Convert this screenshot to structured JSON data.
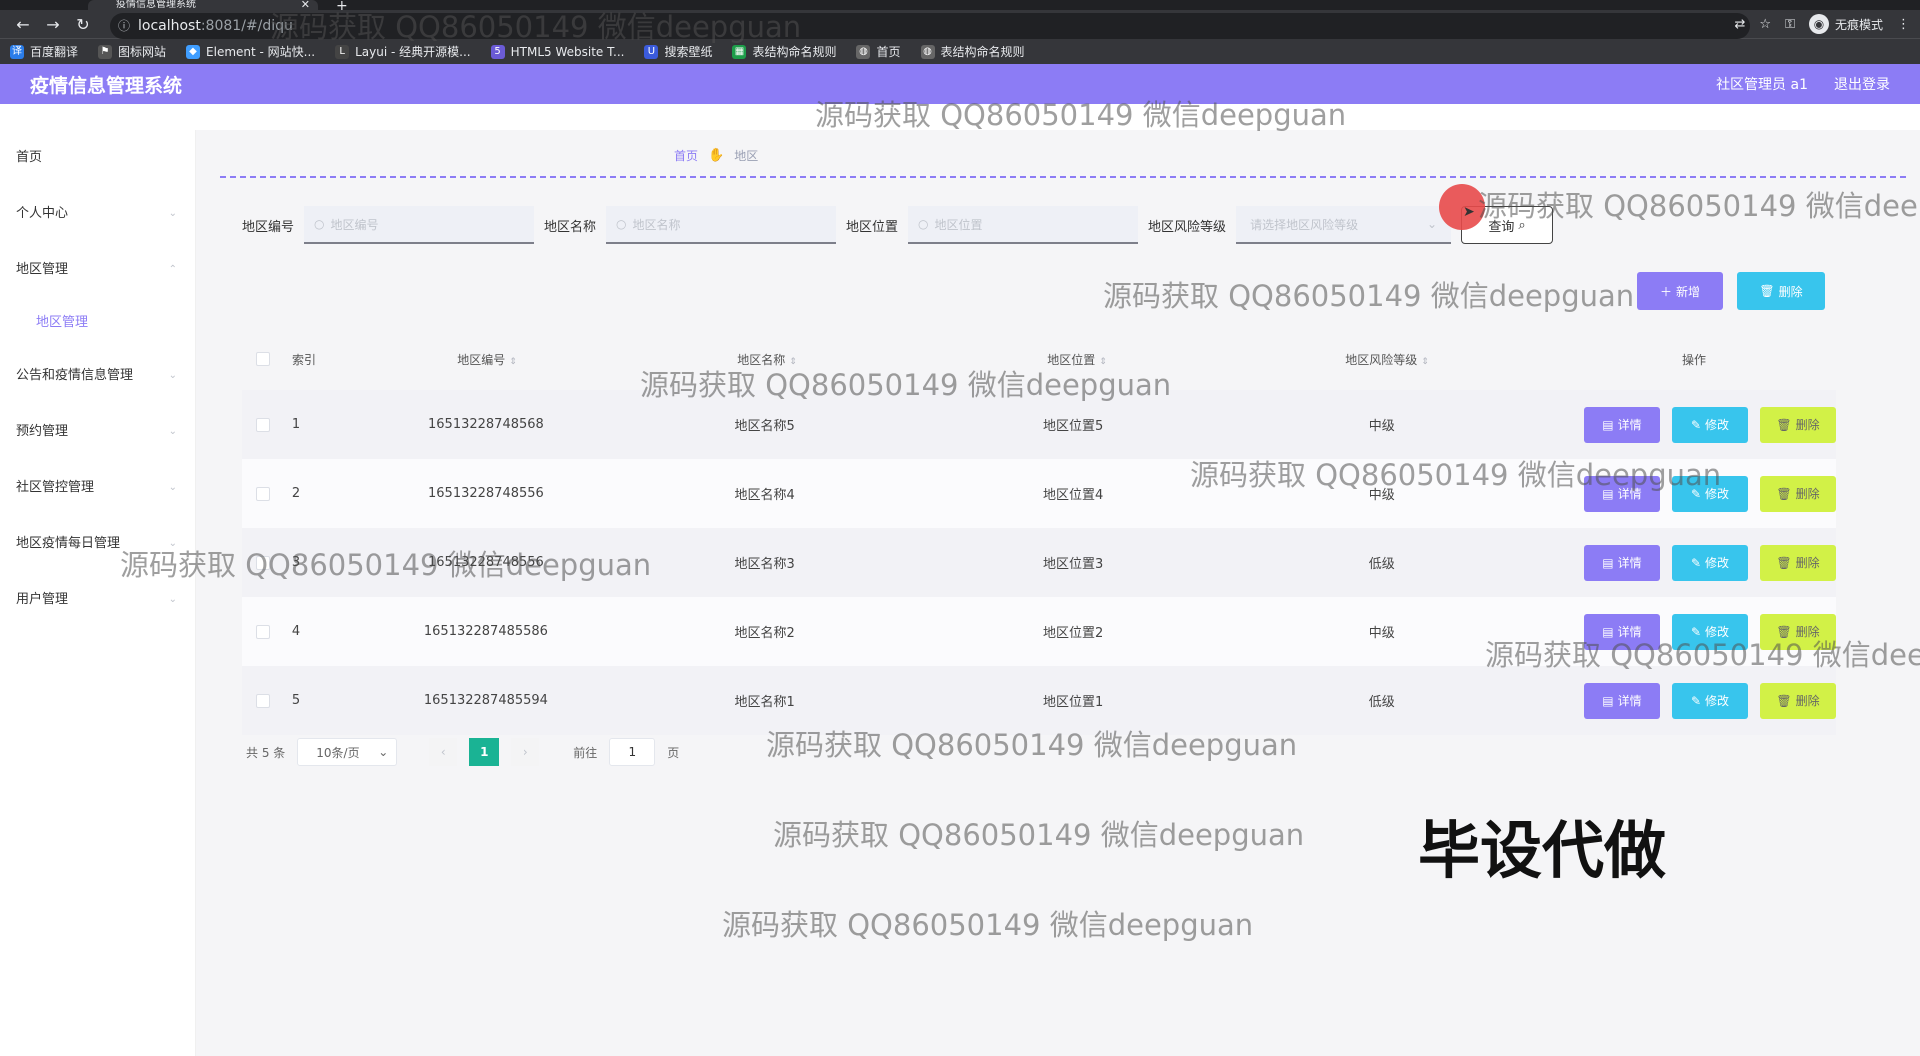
{
  "browser": {
    "tab_title": "疫情信息管理系统",
    "url_host": "localhost",
    "url_path": ":8081/#/diqu",
    "incognito_label": "无痕模式",
    "bookmarks": [
      "百度翻译",
      "图标网站",
      "Element - 网站快...",
      "Layui - 经典开源模...",
      "HTML5 Website T...",
      "搜索壁纸",
      "表结构命名规则",
      "首页",
      "表结构命名规则"
    ]
  },
  "header": {
    "title": "疫情信息管理系统",
    "user": "社区管理员 a1",
    "logout": "退出登录"
  },
  "sidebar": {
    "items": [
      "首页",
      "个人中心",
      "地区管理",
      "公告和疫情信息管理",
      "预约管理",
      "社区管控管理",
      "地区疫情每日管理",
      "用户管理"
    ],
    "sub_item": "地区管理"
  },
  "breadcrumb": {
    "home": "首页",
    "current": "地区"
  },
  "search": {
    "code_label": "地区编号",
    "code_placeholder": "地区编号",
    "name_label": "地区名称",
    "name_placeholder": "地区名称",
    "pos_label": "地区位置",
    "pos_placeholder": "地区位置",
    "risk_label": "地区风险等级",
    "risk_placeholder": "请选择地区风险等级",
    "query_label": "查询"
  },
  "actions": {
    "add": "新增",
    "delete": "删除"
  },
  "table": {
    "headers": {
      "index": "索引",
      "code": "地区编号",
      "name": "地区名称",
      "pos": "地区位置",
      "risk": "地区风险等级",
      "op": "操作"
    },
    "op_labels": {
      "detail": "详情",
      "edit": "修改",
      "delete": "删除"
    },
    "rows": [
      {
        "index": "1",
        "code": "16513228748568",
        "name": "地区名称5",
        "pos": "地区位置5",
        "risk": "中级"
      },
      {
        "index": "2",
        "code": "16513228748556",
        "name": "地区名称4",
        "pos": "地区位置4",
        "risk": "中级"
      },
      {
        "index": "3",
        "code": "16513228748556",
        "name": "地区名称3",
        "pos": "地区位置3",
        "risk": "低级"
      },
      {
        "index": "4",
        "code": "165132287485586",
        "name": "地区名称2",
        "pos": "地区位置2",
        "risk": "中级"
      },
      {
        "index": "5",
        "code": "165132287485594",
        "name": "地区名称1",
        "pos": "地区位置1",
        "risk": "低级"
      }
    ]
  },
  "pagination": {
    "total": "共 5 条",
    "page_size": "10条/页",
    "current": "1",
    "goto_label": "前往",
    "goto_value": "1",
    "page_unit": "页"
  },
  "watermark": {
    "text": "源码获取 QQ86050149 微信deepguan",
    "big": "毕设代做"
  },
  "colors": {
    "primary": "#8c7cf5",
    "info": "#38c5ed",
    "lime": "#d2f147",
    "pager": "#1ab394"
  }
}
